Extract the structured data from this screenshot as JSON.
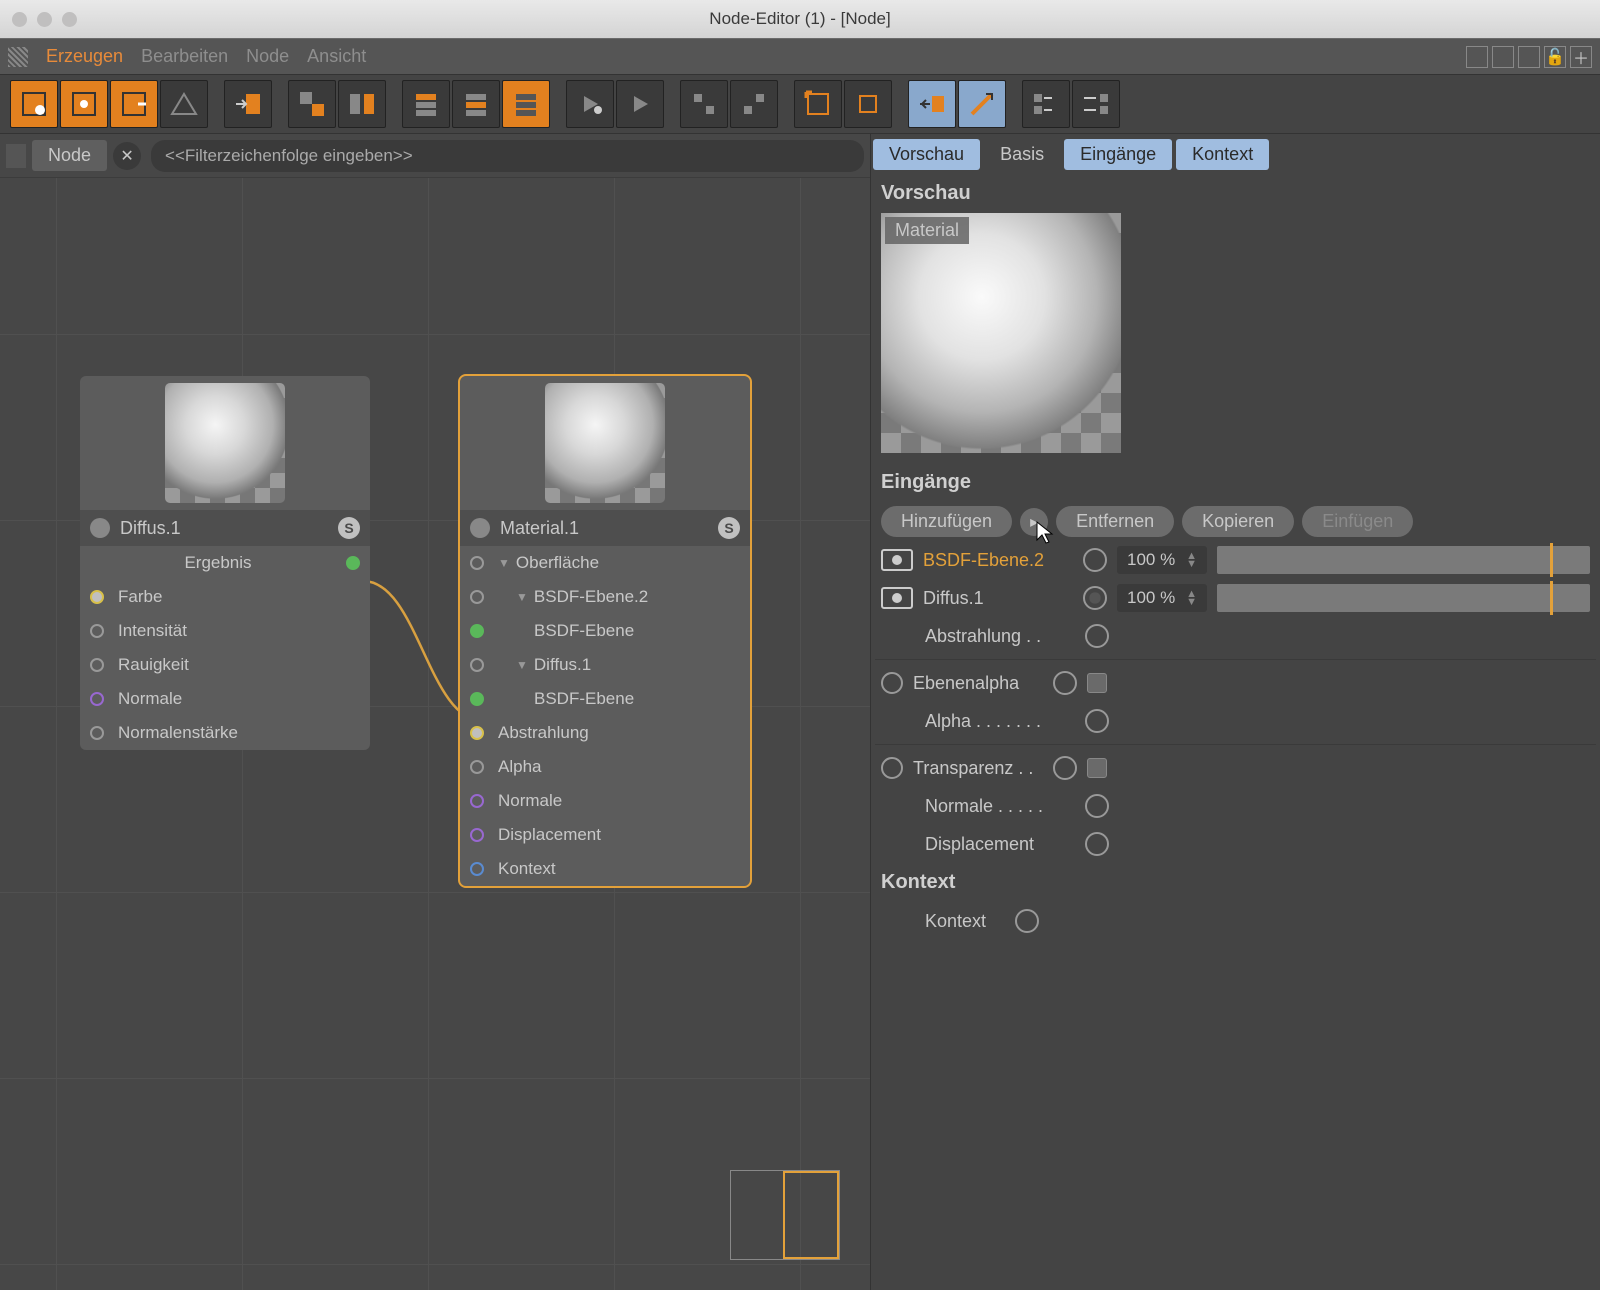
{
  "window": {
    "title": "Node-Editor (1) - [Node]"
  },
  "menu": {
    "items": [
      "Erzeugen",
      "Bearbeiten",
      "Node",
      "Ansicht"
    ],
    "active_index": 0
  },
  "breadcrumb": {
    "label": "Node"
  },
  "filter": {
    "placeholder": "<<Filterzeichenfolge eingeben>>"
  },
  "nodes": {
    "diffus": {
      "title": "Diffus.1",
      "output": "Ergebnis",
      "inputs": [
        "Farbe",
        "Intensität",
        "Rauigkeit",
        "Normale",
        "Normalenstärke"
      ]
    },
    "material": {
      "title": "Material.1",
      "rows": [
        {
          "label": "Oberfläche",
          "indent": 0,
          "arrow": true
        },
        {
          "label": "BSDF-Ebene.2",
          "indent": 1,
          "arrow": true
        },
        {
          "label": "BSDF-Ebene",
          "indent": 2,
          "green": true
        },
        {
          "label": "Diffus.1",
          "indent": 1,
          "arrow": true
        },
        {
          "label": "BSDF-Ebene",
          "indent": 2,
          "green": true
        },
        {
          "label": "Abstrahlung",
          "indent": 0,
          "port": "yellow"
        },
        {
          "label": "Alpha",
          "indent": 0,
          "port": "grey"
        },
        {
          "label": "Normale",
          "indent": 0,
          "port": "purple"
        },
        {
          "label": "Displacement",
          "indent": 0,
          "port": "purple"
        },
        {
          "label": "Kontext",
          "indent": 0,
          "port": "blue"
        }
      ]
    }
  },
  "tabs": {
    "items": [
      "Vorschau",
      "Basis",
      "Eingänge",
      "Kontext"
    ],
    "active": [
      0,
      2,
      3
    ]
  },
  "preview": {
    "section": "Vorschau",
    "label": "Material"
  },
  "eingaenge": {
    "section": "Eingänge",
    "buttons": {
      "add": "Hinzufügen",
      "remove": "Entfernen",
      "copy": "Kopieren",
      "paste": "Einfügen"
    },
    "rows": [
      {
        "label": "BSDF-Ebene.2",
        "percent": "100 %",
        "highlight": true
      },
      {
        "label": "Diffus.1",
        "percent": "100 %"
      }
    ],
    "params": [
      {
        "label": "Abstrahlung . .",
        "socket": true
      },
      {
        "label": "Ebenenalpha",
        "radio": true,
        "socket": true,
        "checkbox": true
      },
      {
        "label": "Alpha . . . . . . .",
        "socket": true
      },
      {
        "label": "Transparenz . .",
        "radio": true,
        "socket": true,
        "checkbox": true
      },
      {
        "label": "Normale . . . . .",
        "socket": true
      },
      {
        "label": "Displacement",
        "socket": true
      }
    ]
  },
  "kontext": {
    "section": "Kontext",
    "label": "Kontext"
  }
}
